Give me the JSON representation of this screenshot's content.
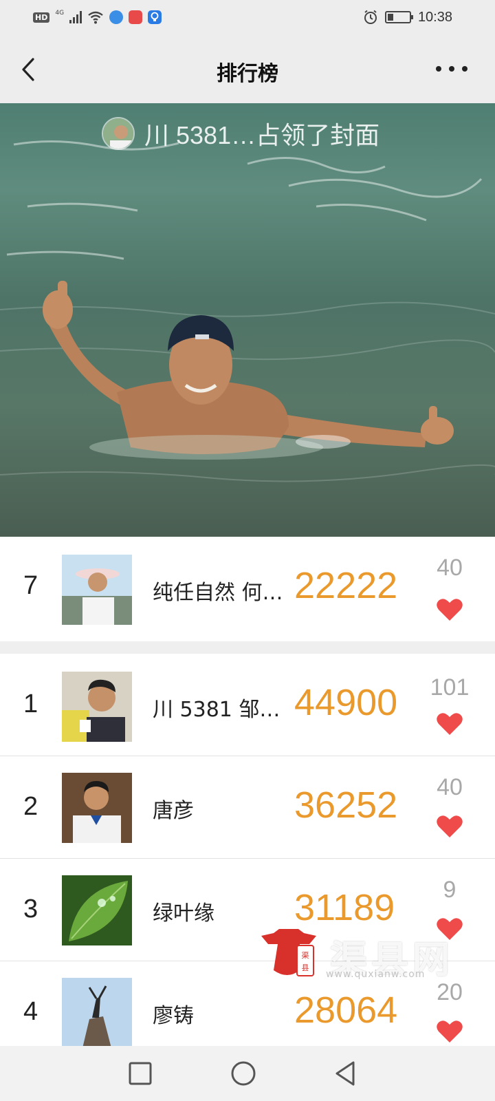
{
  "status_bar": {
    "network_hd": "HD",
    "network_type": "4G",
    "time": "10:38",
    "battery_level": 0.25
  },
  "nav": {
    "title": "排行榜",
    "back_icon": "chevron-left-icon",
    "more_icon": "more-dots-icon"
  },
  "cover": {
    "owner_text": "川 5381…占领了封面"
  },
  "my_rank": {
    "rank": "7",
    "name": "纯任自然 何…",
    "score": "22222",
    "likes": "40"
  },
  "leaderboard": [
    {
      "rank": "1",
      "name": "川 5381 邹…",
      "score": "44900",
      "likes": "101"
    },
    {
      "rank": "2",
      "name": "唐彦",
      "score": "36252",
      "likes": "40"
    },
    {
      "rank": "3",
      "name": "绿叶缘",
      "score": "31189",
      "likes": "9"
    },
    {
      "rank": "4",
      "name": "廖铸",
      "score": "28064",
      "likes": "20"
    }
  ],
  "watermark": {
    "text": "渠县网",
    "url": "www.quxianw.com"
  },
  "colors": {
    "score": "#ea9a2c",
    "heart": "#ef4b4b",
    "likes": "#a8a8a8",
    "bar": "#ededed"
  }
}
